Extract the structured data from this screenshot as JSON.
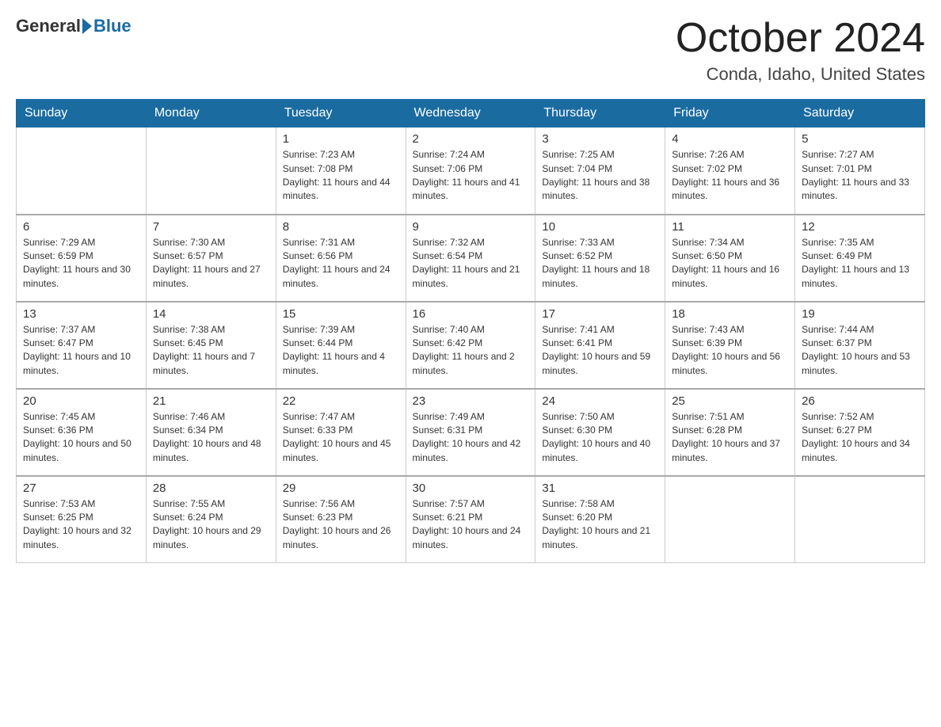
{
  "logo": {
    "general": "General",
    "blue": "Blue"
  },
  "title": {
    "month_year": "October 2024",
    "location": "Conda, Idaho, United States"
  },
  "headers": [
    "Sunday",
    "Monday",
    "Tuesday",
    "Wednesday",
    "Thursday",
    "Friday",
    "Saturday"
  ],
  "weeks": [
    [
      {
        "day": "",
        "sunrise": "",
        "sunset": "",
        "daylight": ""
      },
      {
        "day": "",
        "sunrise": "",
        "sunset": "",
        "daylight": ""
      },
      {
        "day": "1",
        "sunrise": "Sunrise: 7:23 AM",
        "sunset": "Sunset: 7:08 PM",
        "daylight": "Daylight: 11 hours and 44 minutes."
      },
      {
        "day": "2",
        "sunrise": "Sunrise: 7:24 AM",
        "sunset": "Sunset: 7:06 PM",
        "daylight": "Daylight: 11 hours and 41 minutes."
      },
      {
        "day": "3",
        "sunrise": "Sunrise: 7:25 AM",
        "sunset": "Sunset: 7:04 PM",
        "daylight": "Daylight: 11 hours and 38 minutes."
      },
      {
        "day": "4",
        "sunrise": "Sunrise: 7:26 AM",
        "sunset": "Sunset: 7:02 PM",
        "daylight": "Daylight: 11 hours and 36 minutes."
      },
      {
        "day": "5",
        "sunrise": "Sunrise: 7:27 AM",
        "sunset": "Sunset: 7:01 PM",
        "daylight": "Daylight: 11 hours and 33 minutes."
      }
    ],
    [
      {
        "day": "6",
        "sunrise": "Sunrise: 7:29 AM",
        "sunset": "Sunset: 6:59 PM",
        "daylight": "Daylight: 11 hours and 30 minutes."
      },
      {
        "day": "7",
        "sunrise": "Sunrise: 7:30 AM",
        "sunset": "Sunset: 6:57 PM",
        "daylight": "Daylight: 11 hours and 27 minutes."
      },
      {
        "day": "8",
        "sunrise": "Sunrise: 7:31 AM",
        "sunset": "Sunset: 6:56 PM",
        "daylight": "Daylight: 11 hours and 24 minutes."
      },
      {
        "day": "9",
        "sunrise": "Sunrise: 7:32 AM",
        "sunset": "Sunset: 6:54 PM",
        "daylight": "Daylight: 11 hours and 21 minutes."
      },
      {
        "day": "10",
        "sunrise": "Sunrise: 7:33 AM",
        "sunset": "Sunset: 6:52 PM",
        "daylight": "Daylight: 11 hours and 18 minutes."
      },
      {
        "day": "11",
        "sunrise": "Sunrise: 7:34 AM",
        "sunset": "Sunset: 6:50 PM",
        "daylight": "Daylight: 11 hours and 16 minutes."
      },
      {
        "day": "12",
        "sunrise": "Sunrise: 7:35 AM",
        "sunset": "Sunset: 6:49 PM",
        "daylight": "Daylight: 11 hours and 13 minutes."
      }
    ],
    [
      {
        "day": "13",
        "sunrise": "Sunrise: 7:37 AM",
        "sunset": "Sunset: 6:47 PM",
        "daylight": "Daylight: 11 hours and 10 minutes."
      },
      {
        "day": "14",
        "sunrise": "Sunrise: 7:38 AM",
        "sunset": "Sunset: 6:45 PM",
        "daylight": "Daylight: 11 hours and 7 minutes."
      },
      {
        "day": "15",
        "sunrise": "Sunrise: 7:39 AM",
        "sunset": "Sunset: 6:44 PM",
        "daylight": "Daylight: 11 hours and 4 minutes."
      },
      {
        "day": "16",
        "sunrise": "Sunrise: 7:40 AM",
        "sunset": "Sunset: 6:42 PM",
        "daylight": "Daylight: 11 hours and 2 minutes."
      },
      {
        "day": "17",
        "sunrise": "Sunrise: 7:41 AM",
        "sunset": "Sunset: 6:41 PM",
        "daylight": "Daylight: 10 hours and 59 minutes."
      },
      {
        "day": "18",
        "sunrise": "Sunrise: 7:43 AM",
        "sunset": "Sunset: 6:39 PM",
        "daylight": "Daylight: 10 hours and 56 minutes."
      },
      {
        "day": "19",
        "sunrise": "Sunrise: 7:44 AM",
        "sunset": "Sunset: 6:37 PM",
        "daylight": "Daylight: 10 hours and 53 minutes."
      }
    ],
    [
      {
        "day": "20",
        "sunrise": "Sunrise: 7:45 AM",
        "sunset": "Sunset: 6:36 PM",
        "daylight": "Daylight: 10 hours and 50 minutes."
      },
      {
        "day": "21",
        "sunrise": "Sunrise: 7:46 AM",
        "sunset": "Sunset: 6:34 PM",
        "daylight": "Daylight: 10 hours and 48 minutes."
      },
      {
        "day": "22",
        "sunrise": "Sunrise: 7:47 AM",
        "sunset": "Sunset: 6:33 PM",
        "daylight": "Daylight: 10 hours and 45 minutes."
      },
      {
        "day": "23",
        "sunrise": "Sunrise: 7:49 AM",
        "sunset": "Sunset: 6:31 PM",
        "daylight": "Daylight: 10 hours and 42 minutes."
      },
      {
        "day": "24",
        "sunrise": "Sunrise: 7:50 AM",
        "sunset": "Sunset: 6:30 PM",
        "daylight": "Daylight: 10 hours and 40 minutes."
      },
      {
        "day": "25",
        "sunrise": "Sunrise: 7:51 AM",
        "sunset": "Sunset: 6:28 PM",
        "daylight": "Daylight: 10 hours and 37 minutes."
      },
      {
        "day": "26",
        "sunrise": "Sunrise: 7:52 AM",
        "sunset": "Sunset: 6:27 PM",
        "daylight": "Daylight: 10 hours and 34 minutes."
      }
    ],
    [
      {
        "day": "27",
        "sunrise": "Sunrise: 7:53 AM",
        "sunset": "Sunset: 6:25 PM",
        "daylight": "Daylight: 10 hours and 32 minutes."
      },
      {
        "day": "28",
        "sunrise": "Sunrise: 7:55 AM",
        "sunset": "Sunset: 6:24 PM",
        "daylight": "Daylight: 10 hours and 29 minutes."
      },
      {
        "day": "29",
        "sunrise": "Sunrise: 7:56 AM",
        "sunset": "Sunset: 6:23 PM",
        "daylight": "Daylight: 10 hours and 26 minutes."
      },
      {
        "day": "30",
        "sunrise": "Sunrise: 7:57 AM",
        "sunset": "Sunset: 6:21 PM",
        "daylight": "Daylight: 10 hours and 24 minutes."
      },
      {
        "day": "31",
        "sunrise": "Sunrise: 7:58 AM",
        "sunset": "Sunset: 6:20 PM",
        "daylight": "Daylight: 10 hours and 21 minutes."
      },
      {
        "day": "",
        "sunrise": "",
        "sunset": "",
        "daylight": ""
      },
      {
        "day": "",
        "sunrise": "",
        "sunset": "",
        "daylight": ""
      }
    ]
  ]
}
